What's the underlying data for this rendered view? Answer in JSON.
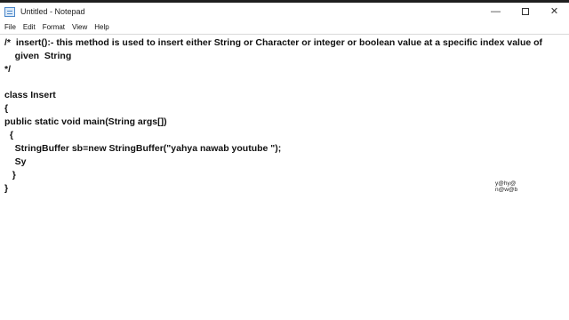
{
  "window": {
    "title": "Untitled - Notepad",
    "controls": {
      "minimize": "—",
      "close": "✕"
    }
  },
  "menu": {
    "items": [
      "File",
      "Edit",
      "Format",
      "View",
      "Help"
    ]
  },
  "editor": {
    "lines": [
      "/*  insert():- this method is used to insert either String or Character or integer or boolean value at a specific index value of",
      "    given  String",
      "*/",
      "",
      "class Insert",
      "{",
      "public static void main(String args[])",
      "  {",
      "    StringBuffer sb=new StringBuffer(\"yahya nawab youtube \");",
      "    Sy",
      "   }",
      "}"
    ]
  },
  "overlay_note": {
    "line1": "y@hy@",
    "line2": "n@w@b"
  }
}
